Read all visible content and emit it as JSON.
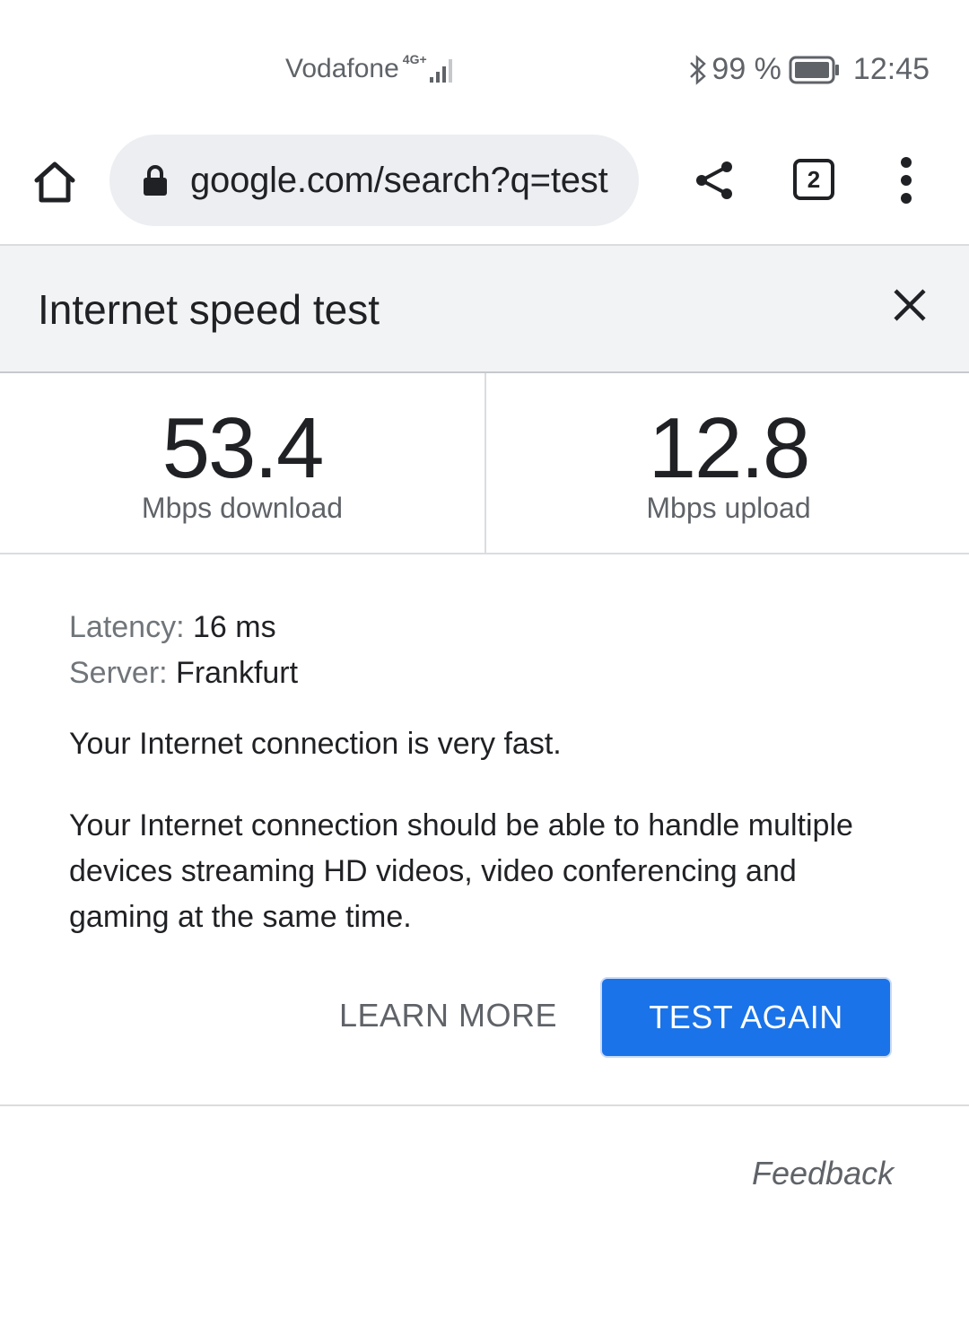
{
  "status_bar": {
    "carrier": "Vodafone",
    "network": "4G+",
    "battery": "99 %",
    "time": "12:45"
  },
  "toolbar": {
    "url": "google.com/search?q=test",
    "tab_count": "2"
  },
  "card": {
    "title": "Internet speed test"
  },
  "results": {
    "download_value": "53.4",
    "download_unit": "Mbps download",
    "upload_value": "12.8",
    "upload_unit": "Mbps upload"
  },
  "details": {
    "latency_label": "Latency:",
    "latency_value": "16 ms",
    "server_label": "Server:",
    "server_value": "Frankfurt",
    "verdict": "Your Internet connection is very fast.",
    "description": "Your Internet connection should be able to handle multiple devices streaming HD videos, video conferencing and gaming at the same time."
  },
  "actions": {
    "learn_more": "LEARN MORE",
    "test_again": "TEST AGAIN",
    "feedback": "Feedback"
  },
  "colors": {
    "accent": "#1a73e8",
    "header_bg": "#f1f3f4",
    "url_bar_bg": "#eceef1"
  }
}
